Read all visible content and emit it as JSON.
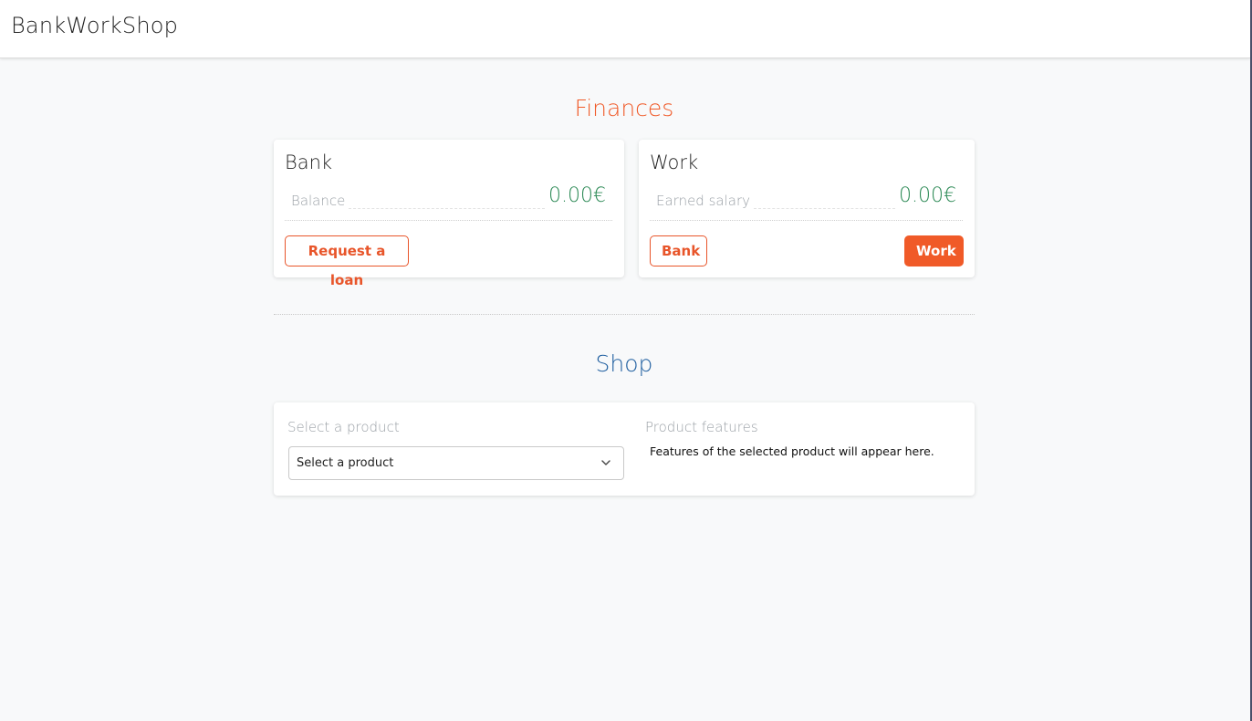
{
  "navbar": {
    "brand": "BankWorkShop"
  },
  "finances": {
    "title": "Finances",
    "bank": {
      "title": "Bank",
      "balance_label": "Balance",
      "balance_value": "0.00€",
      "loan_button": "Request a loan"
    },
    "work": {
      "title": "Work",
      "salary_label": "Earned salary",
      "salary_value": "0.00€",
      "bank_button": "Bank",
      "work_button": "Work"
    }
  },
  "shop": {
    "title": "Shop",
    "select_label": "Select a product",
    "select_value": "Select a product",
    "features_label": "Product features",
    "features_text": "Features of the selected product will appear here."
  },
  "colors": {
    "accent": "#f05a28",
    "shop_title": "#1f5fa0",
    "money": "#2e8b57",
    "muted": "#9aa0a6",
    "background": "#f8f9fa"
  },
  "icons": {
    "select_chevron": "chevron-down-icon"
  }
}
